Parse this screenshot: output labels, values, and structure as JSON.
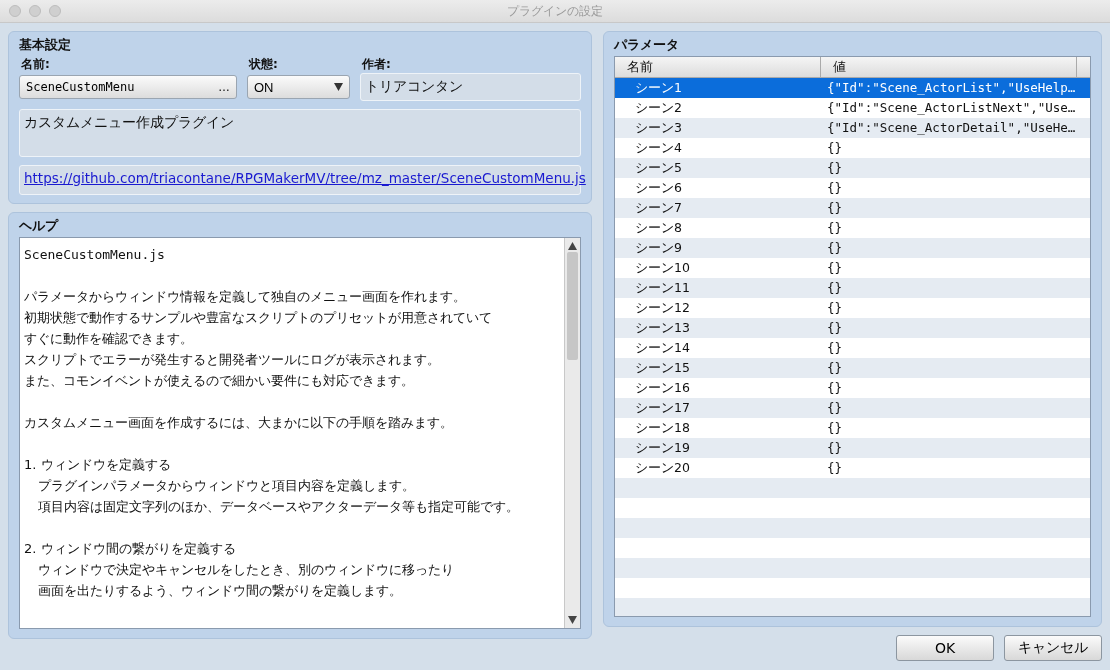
{
  "window": {
    "title": "プラグインの設定"
  },
  "basic": {
    "title": "基本設定",
    "name_label": "名前:",
    "name_value": "SceneCustomMenu",
    "name_button": "…",
    "status_label": "状態:",
    "status_value": "ON",
    "author_label": "作者:",
    "author_value": "トリアコンタン",
    "description": "カスタムメニュー作成プラグイン",
    "url": "https://github.com/triacontane/RPGMakerMV/tree/mz_master/SceneCustomMenu.js"
  },
  "help": {
    "title": "ヘルプ",
    "paragraphs": [
      [
        {
          "text": "SceneCustomMenu.js",
          "indented": false
        }
      ],
      [
        {
          "text": "パラメータからウィンドウ情報を定義して独自のメニュー画面を作れます。",
          "indented": false
        },
        {
          "text": "初期状態で動作するサンプルや豊富なスクリプトのプリセットが用意されていて",
          "indented": false
        },
        {
          "text": "すぐに動作を確認できます。",
          "indented": false
        },
        {
          "text": "スクリプトでエラーが発生すると開発者ツールにログが表示されます。",
          "indented": false
        },
        {
          "text": "また、コモンイベントが使えるので細かい要件にも対応できます。",
          "indented": false
        }
      ],
      [
        {
          "text": "カスタムメニュー画面を作成するには、大まかに以下の手順を踏みます。",
          "indented": false
        }
      ],
      [
        {
          "text": "1. ウィンドウを定義する",
          "indented": false
        },
        {
          "text": "プラグインパラメータからウィンドウと項目内容を定義します。",
          "indented": true
        },
        {
          "text": "項目内容は固定文字列のほか、データベースやアクターデータ等も指定可能です。",
          "indented": true
        }
      ],
      [
        {
          "text": "2. ウィンドウ間の繋がりを定義する",
          "indented": false
        },
        {
          "text": "ウィンドウで決定やキャンセルをしたとき、別のウィンドウに移ったり",
          "indented": true
        },
        {
          "text": "画面を出たりするよう、ウィンドウ間の繋がりを定義します。",
          "indented": true
        }
      ]
    ]
  },
  "parameters": {
    "title": "パラメータ",
    "columns": [
      "名前",
      "値"
    ],
    "rows": [
      {
        "name": "シーン1",
        "value": "{\"Id\":\"Scene_ActorList\",\"UseHelp…",
        "selected": true
      },
      {
        "name": "シーン2",
        "value": "{\"Id\":\"Scene_ActorListNext\",\"Use…",
        "selected": false
      },
      {
        "name": "シーン3",
        "value": "{\"Id\":\"Scene_ActorDetail\",\"UseHe…",
        "selected": false
      },
      {
        "name": "シーン4",
        "value": "{}",
        "selected": false
      },
      {
        "name": "シーン5",
        "value": "{}",
        "selected": false
      },
      {
        "name": "シーン6",
        "value": "{}",
        "selected": false
      },
      {
        "name": "シーン7",
        "value": "{}",
        "selected": false
      },
      {
        "name": "シーン8",
        "value": "{}",
        "selected": false
      },
      {
        "name": "シーン9",
        "value": "{}",
        "selected": false
      },
      {
        "name": "シーン10",
        "value": "{}",
        "selected": false
      },
      {
        "name": "シーン11",
        "value": "{}",
        "selected": false
      },
      {
        "name": "シーン12",
        "value": "{}",
        "selected": false
      },
      {
        "name": "シーン13",
        "value": "{}",
        "selected": false
      },
      {
        "name": "シーン14",
        "value": "{}",
        "selected": false
      },
      {
        "name": "シーン15",
        "value": "{}",
        "selected": false
      },
      {
        "name": "シーン16",
        "value": "{}",
        "selected": false
      },
      {
        "name": "シーン17",
        "value": "{}",
        "selected": false
      },
      {
        "name": "シーン18",
        "value": "{}",
        "selected": false
      },
      {
        "name": "シーン19",
        "value": "{}",
        "selected": false
      },
      {
        "name": "シーン20",
        "value": "{}",
        "selected": false
      }
    ]
  },
  "buttons": [
    "OK",
    "キャンセル"
  ]
}
